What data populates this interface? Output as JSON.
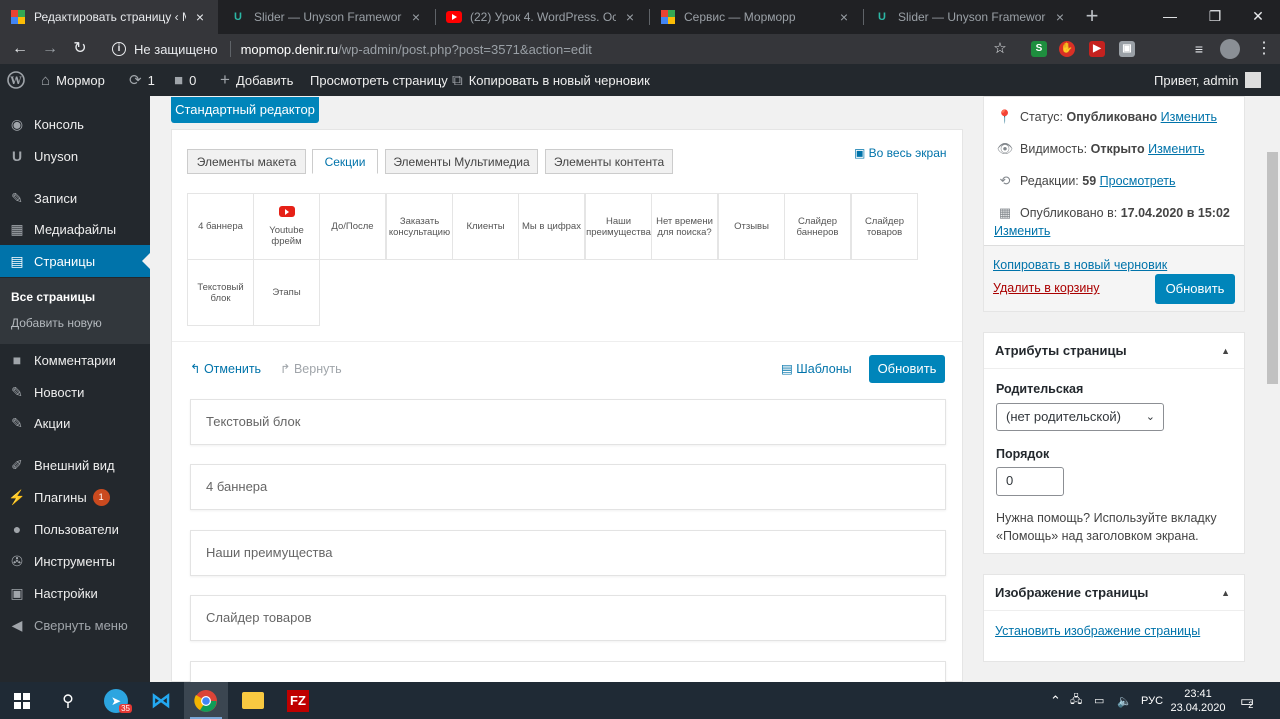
{
  "browser": {
    "tabs": [
      {
        "title": "Редактировать страницу ‹ Мо",
        "icon": "wp-multicolor-icon",
        "active": true
      },
      {
        "title": "Slider — Unyson Framework d",
        "icon": "unyson-icon"
      },
      {
        "title": "(22) Урок 4. WordPress. Осно",
        "icon": "youtube-icon"
      },
      {
        "title": "Сервис — Морморр",
        "icon": "wp-multicolor-icon"
      },
      {
        "title": "Slider — Unyson Framework d",
        "icon": "unyson-icon"
      }
    ],
    "address": {
      "not_secure": "Не защищено",
      "host": "mopmop.denir.ru",
      "path": "/wp-admin/post.php?post=3571&action=edit"
    }
  },
  "adminbar": {
    "site": "Мормор",
    "updates": "1",
    "comments": "0",
    "add": "Добавить",
    "view": "Просмотреть страницу",
    "copy": "Копировать в новый черновик",
    "greeting": "Привет, admin"
  },
  "sidebar": {
    "items": [
      {
        "label": "Консоль",
        "icon": "dashboard-icon"
      },
      {
        "label": "Unyson",
        "icon": "unyson-icon"
      },
      {
        "label": "Записи",
        "icon": "pin-icon"
      },
      {
        "label": "Медиафайлы",
        "icon": "media-icon"
      },
      {
        "label": "Страницы",
        "icon": "page-icon"
      },
      {
        "label": "Комментарии",
        "icon": "comment-icon"
      },
      {
        "label": "Новости",
        "icon": "pin-icon"
      },
      {
        "label": "Акции",
        "icon": "pin-icon"
      },
      {
        "label": "Внешний вид",
        "icon": "brush-icon"
      },
      {
        "label": "Плагины",
        "icon": "plugin-icon",
        "badge": "1"
      },
      {
        "label": "Пользователи",
        "icon": "user-icon"
      },
      {
        "label": "Инструменты",
        "icon": "wrench-icon"
      },
      {
        "label": "Настройки",
        "icon": "settings-icon"
      },
      {
        "label": "Свернуть меню",
        "icon": "collapse-icon"
      }
    ],
    "submenu": [
      "Все страницы",
      "Добавить новую"
    ]
  },
  "editor": {
    "standard_editor": "Стандартный редактор",
    "tabs": [
      "Элементы макета",
      "Секции",
      "Элементы Мультимедиа",
      "Элементы контента"
    ],
    "fullscreen": "Во весь экран",
    "sections": [
      "4 баннера",
      "Youtube фрейм",
      "До/После",
      "Заказать консультацию",
      "Клиенты",
      "Мы в цифрах",
      "Наши преимущества",
      "Нет времени для поиска?",
      "Отзывы",
      "Слайдер баннеров",
      "Слайдер товаров",
      "Текстовый блок",
      "Этапы"
    ],
    "undo": "Отменить",
    "redo": "Вернуть",
    "templates": "Шаблоны",
    "update": "Обновить",
    "blocks": [
      "Текстовый блок",
      "4 баннера",
      "Наши преимущества",
      "Слайдер товаров"
    ]
  },
  "publish": {
    "status_label": "Статус:",
    "status_value": "Опубликовано",
    "visibility_label": "Видимость:",
    "visibility_value": "Открыто",
    "revisions_label": "Редакции:",
    "revisions_value": "59",
    "revisions_link": "Просмотреть",
    "published_label": "Опубликовано в:",
    "published_value": "17.04.2020 в 15:02",
    "change": "Изменить",
    "copy_draft": "Копировать в новый черновик",
    "trash": "Удалить в корзину",
    "update": "Обновить"
  },
  "attributes": {
    "title": "Атрибуты страницы",
    "parent_label": "Родительская",
    "parent_value": "(нет родительской)",
    "order_label": "Порядок",
    "order_value": "0",
    "help": "Нужна помощь? Используйте вкладку «Помощь» над заголовком экрана."
  },
  "featured": {
    "title": "Изображение страницы",
    "link": "Установить изображение страницы"
  },
  "taskbar": {
    "lang": "РУС",
    "time": "23:41",
    "date": "23.04.2020",
    "notifications": "2",
    "telegram_badge": "35"
  },
  "colors": {
    "wp_blue": "#0073aa",
    "button_blue": "#0085ba",
    "admin_dark": "#23282d",
    "trash_red": "#a00"
  }
}
